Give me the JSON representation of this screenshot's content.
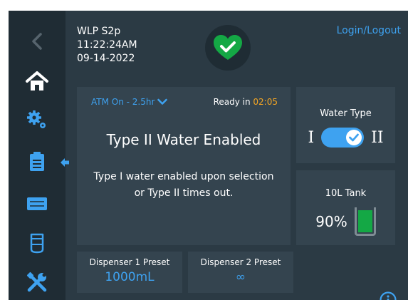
{
  "header": {
    "device_name": "WLP S2p",
    "time": "11:22:24AM",
    "date": "09-14-2022",
    "login_label": "Login/Logout"
  },
  "status_icon": "heart-check-icon",
  "sidebar": {
    "items": [
      {
        "icon": "back-chevron-icon"
      },
      {
        "icon": "home-icon"
      },
      {
        "icon": "settings-gears-icon"
      },
      {
        "icon": "clipboard-icon"
      },
      {
        "icon": "cartridge-icon"
      },
      {
        "icon": "cylinder-icon"
      },
      {
        "icon": "tools-icon"
      }
    ],
    "collapse_icon": "arrow-left-icon"
  },
  "main_card": {
    "atm_label": "ATM On - 2.5hr",
    "ready_label": "Ready in",
    "ready_time": "02:05",
    "title": "Type II Water Enabled",
    "message_line1": "Type I water enabled upon selection",
    "message_line2": "or Type II times out."
  },
  "water_type": {
    "title": "Water Type",
    "left_label": "I",
    "right_label": "II",
    "selected": "II"
  },
  "tank": {
    "title": "10L Tank",
    "percent_label": "90%",
    "level": 0.9
  },
  "presets": [
    {
      "label": "Dispenser 1 Preset",
      "value": "1000mL"
    },
    {
      "label": "Dispenser 2 Preset",
      "value": "∞"
    }
  ],
  "info_icon": "info-icon",
  "colors": {
    "background": "#2b3a44",
    "sidebar": "#1f2c34",
    "card": "#34444f",
    "accent": "#3ea2f0",
    "status_green": "#14a845",
    "warning_orange": "#f5a623"
  }
}
